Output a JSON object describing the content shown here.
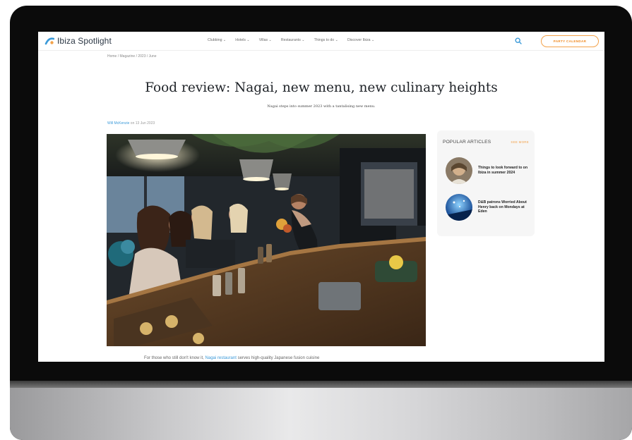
{
  "site": {
    "name": "Ibiza Spotlight"
  },
  "nav": {
    "items": [
      "Clubbing ⌄",
      "Hotels ⌄",
      "Villas ⌄",
      "Restaurants ⌄",
      "Things to do ⌄",
      "Discover Ibiza ⌄"
    ],
    "party_calendar": "PARTY CALENDAR",
    "search_icon": "search-icon"
  },
  "breadcrumb": "Home / Magazine / 2023 / June",
  "article": {
    "title": "Food review: Nagai, new menu, new culinary heights",
    "subtitle": "Nagai steps into summer 2023 with a tantalising new menu.",
    "author": "Will McKenzie",
    "date_prefix": " on ",
    "date": "13 Jun 2023",
    "caption_start": "For those who still don't know it,",
    "caption_link": "Nagai restaurant",
    "caption_end": "serves high-quality Japanese fusion cuisine"
  },
  "sidebar": {
    "title": "POPULAR ARTICLES",
    "see_more": "SEE MORE",
    "items": [
      {
        "text": "Things to look forward to on Ibiza in summer 2024"
      },
      {
        "text": "D&B patrons Worried About Henry back on Mondays at Eden"
      }
    ]
  },
  "colors": {
    "accent": "#f3a24a",
    "link": "#3b9ad9",
    "logo": "#3b9ad9"
  }
}
